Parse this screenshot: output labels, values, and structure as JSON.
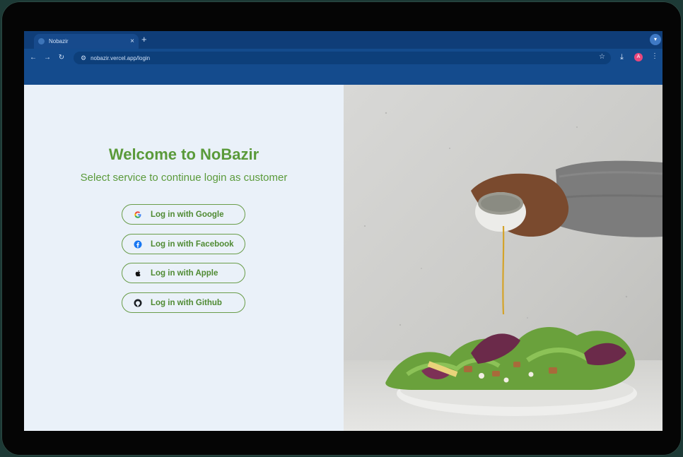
{
  "browser": {
    "tab_title": "Nobazir",
    "tab_close": "×",
    "new_tab": "+",
    "url": "nobazir.vercel.app/login",
    "profile_initial": "A"
  },
  "page": {
    "title": "Welcome to NoBazir",
    "subtitle": "Select service to continue login as customer",
    "buttons": [
      {
        "label": "Log in with Google"
      },
      {
        "label": "Log in with Facebook"
      },
      {
        "label": "Log in with Apple"
      },
      {
        "label": "Log in with Github"
      }
    ]
  },
  "colors": {
    "accent_green": "#5a9a3a",
    "browser_blue": "#144b8d",
    "page_bg": "#eaf1f9"
  }
}
